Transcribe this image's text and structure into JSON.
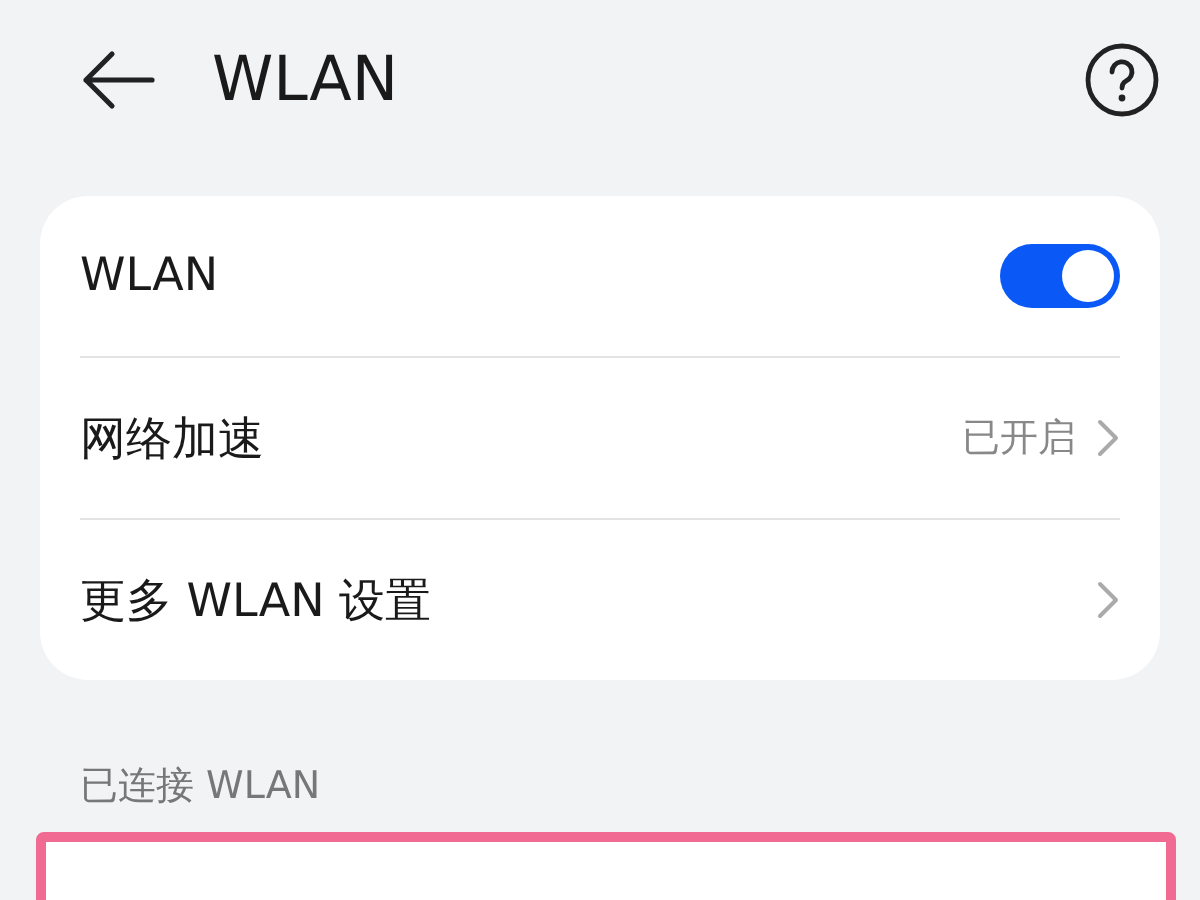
{
  "header": {
    "title": "WLAN"
  },
  "settings": [
    {
      "kind": "toggle",
      "label": "WLAN",
      "on": true
    },
    {
      "kind": "link",
      "label": "网络加速",
      "value": "已开启"
    },
    {
      "kind": "link",
      "label": "更多 WLAN 设置"
    }
  ],
  "connected_section": {
    "title": "已连接 WLAN",
    "highlighted": true
  }
}
